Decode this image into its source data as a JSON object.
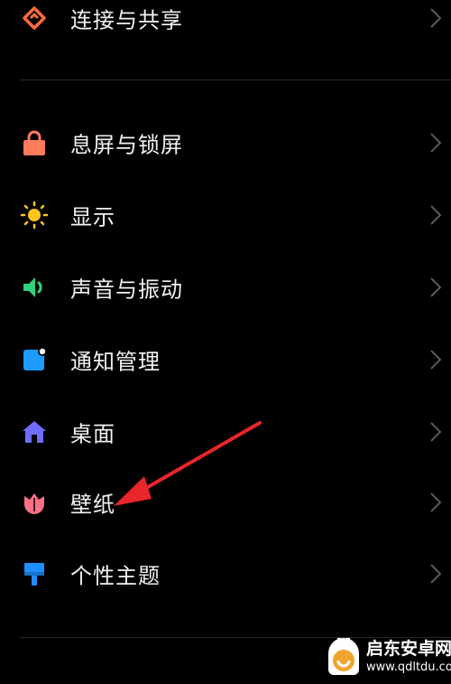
{
  "settings": {
    "items": [
      {
        "label": "连接与共享",
        "icon": "connection-share-icon",
        "color": "#ff6a3d"
      },
      {
        "label": "息屏与锁屏",
        "icon": "lock-icon",
        "color": "#ff7b5e"
      },
      {
        "label": "显示",
        "icon": "sun-icon",
        "color": "#ffc61a"
      },
      {
        "label": "声音与振动",
        "icon": "speaker-icon",
        "color": "#2fd27a"
      },
      {
        "label": "通知管理",
        "icon": "notification-icon",
        "color": "#1e9bff"
      },
      {
        "label": "桌面",
        "icon": "home-icon",
        "color": "#6f6cff"
      },
      {
        "label": "壁纸",
        "icon": "tulip-icon",
        "color": "#ff6f86"
      },
      {
        "label": "个性主题",
        "icon": "paint-brush-icon",
        "color": "#1e8fff"
      }
    ]
  },
  "annotation": {
    "arrow_color": "#e8262b"
  },
  "watermark": {
    "title": "启东安卓网",
    "url": "www.qdltdu.com",
    "logo_color": "#f0a52e"
  }
}
